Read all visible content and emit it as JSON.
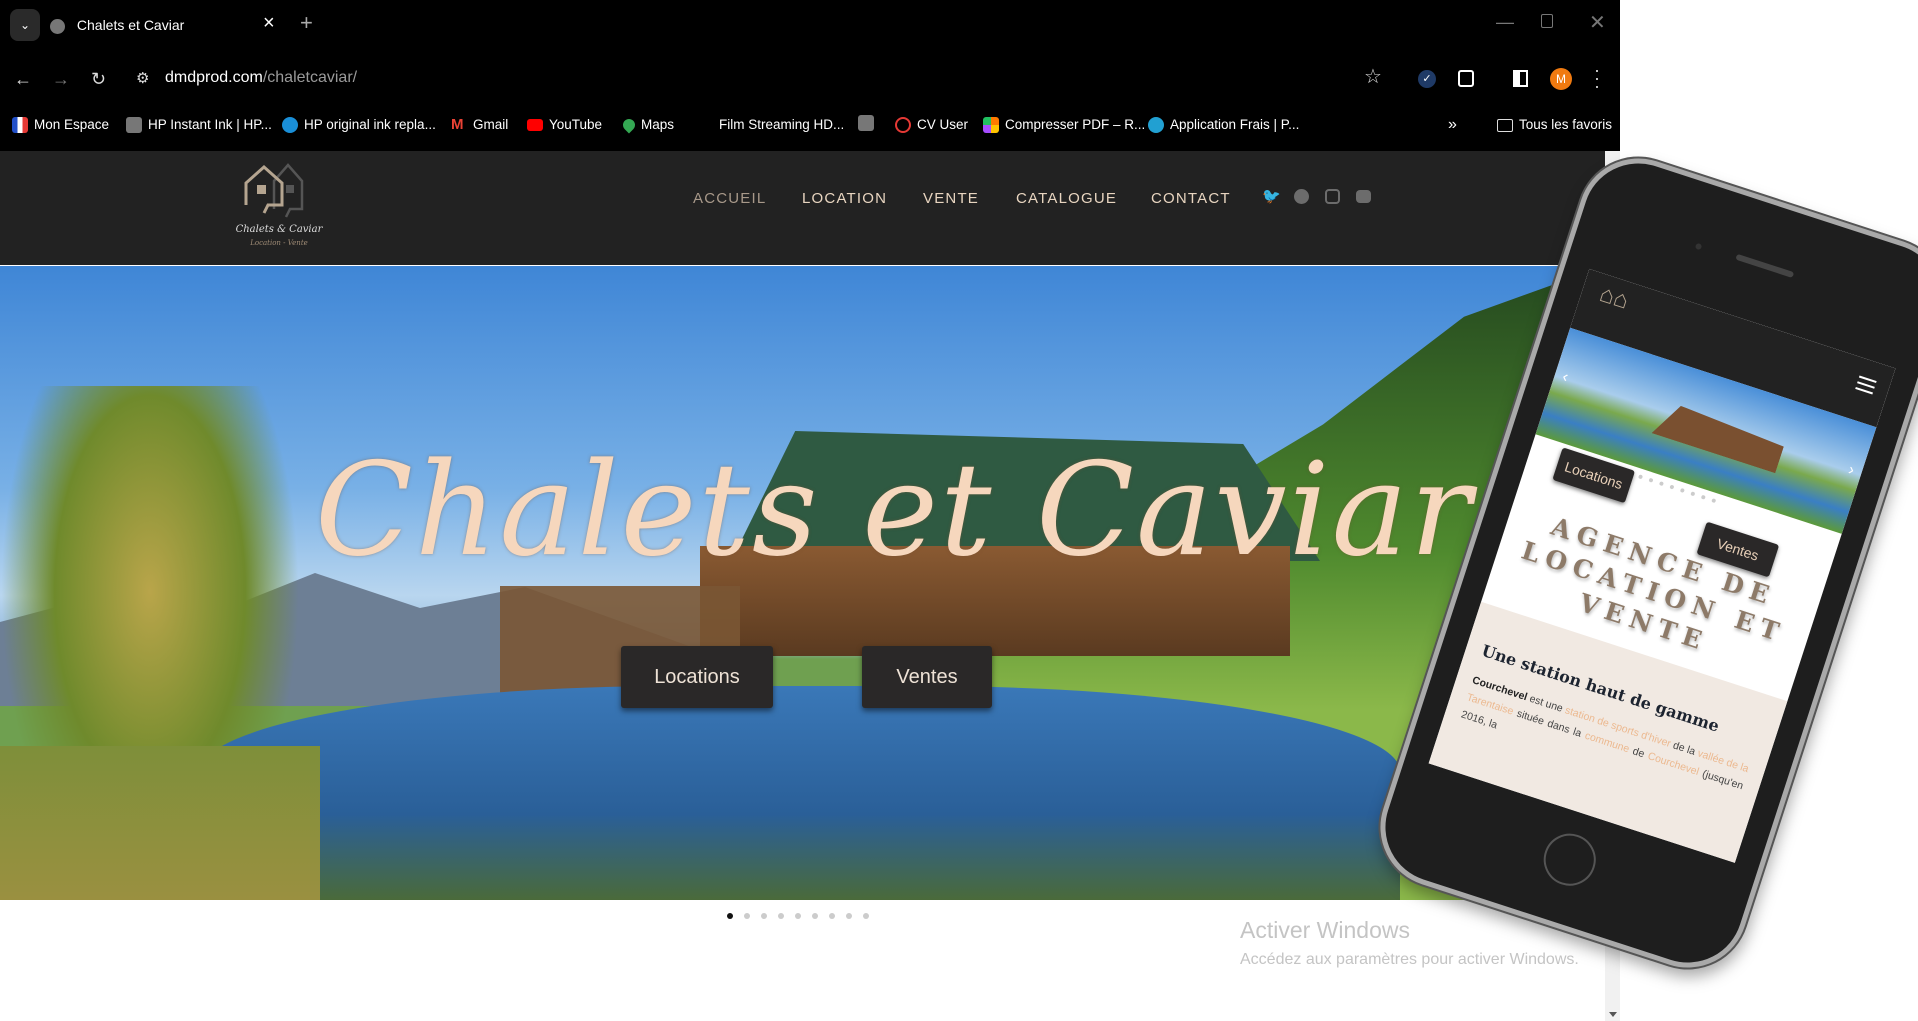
{
  "browser": {
    "tab_title": "Chalets et Caviar",
    "tab_close": "×",
    "new_tab": "+",
    "url_domain": "dmdprod.com",
    "url_path": "/chaletcaviar/",
    "profile_initial": "M",
    "bookmarks": [
      {
        "label": "Mon Espace",
        "icon": "marianne-icon",
        "color": "#2250c8"
      },
      {
        "label": "HP Instant Ink | HP...",
        "icon": "globe-icon",
        "color": "#777777"
      },
      {
        "label": "HP original ink repla...",
        "icon": "hp-icon",
        "color": "#1a8fd8"
      },
      {
        "label": "Gmail",
        "icon": "gmail-icon",
        "color": "#e94235"
      },
      {
        "label": "YouTube",
        "icon": "youtube-icon",
        "color": "#ff0000"
      },
      {
        "label": "Maps",
        "icon": "maps-icon",
        "color": "#34a853"
      },
      {
        "label": "Film Streaming HD...",
        "icon": "none",
        "color": ""
      },
      {
        "label": "",
        "icon": "globe-icon",
        "color": "#777777"
      },
      {
        "label": "CV User",
        "icon": "check-circle-icon",
        "color": "#e53935"
      },
      {
        "label": "Compresser PDF – R...",
        "icon": "grid-icon",
        "color": "#ff7a00"
      },
      {
        "label": "Application Frais | P...",
        "icon": "wordpress-icon",
        "color": "#21a0d2"
      }
    ],
    "more_bookmarks": "»",
    "all_bookmarks": "Tous les favoris"
  },
  "site": {
    "logo_text": "Chalets & Caviar",
    "logo_sub": "Location - Vente",
    "nav": [
      "ACCUEIL",
      "LOCATION",
      "VENTE",
      "CATALOGUE",
      "CONTACT"
    ],
    "active_nav": "ACCUEIL",
    "social": [
      "twitter-icon",
      "facebook-icon",
      "instagram-icon",
      "youtube-icon"
    ],
    "hero_title": "Chalets et Caviar",
    "btn_locations": "Locations",
    "btn_ventes": "Ventes",
    "slide_count": 9,
    "active_slide": 1
  },
  "phone": {
    "btn_locations": "Locations",
    "btn_ventes": "Ventes",
    "title": "AGENCE DE LOCATION ET VENTE",
    "subtitle": "Une station haut de gamme",
    "p_bold": "Courchevel",
    "p1": " est une ",
    "p_link1": "station de sports d'hiver",
    "p2": " de la ",
    "p_link2": "vallée de la Tarentaise",
    "p3": " située dans la ",
    "p_link3": "commune",
    "p4": " de ",
    "p_link4": "Courchevel",
    "p5": " (jusqu'en 2016, la"
  },
  "watermark": {
    "title": "Activer Windows",
    "subtitle": "Accédez aux paramètres pour activer Windows."
  }
}
